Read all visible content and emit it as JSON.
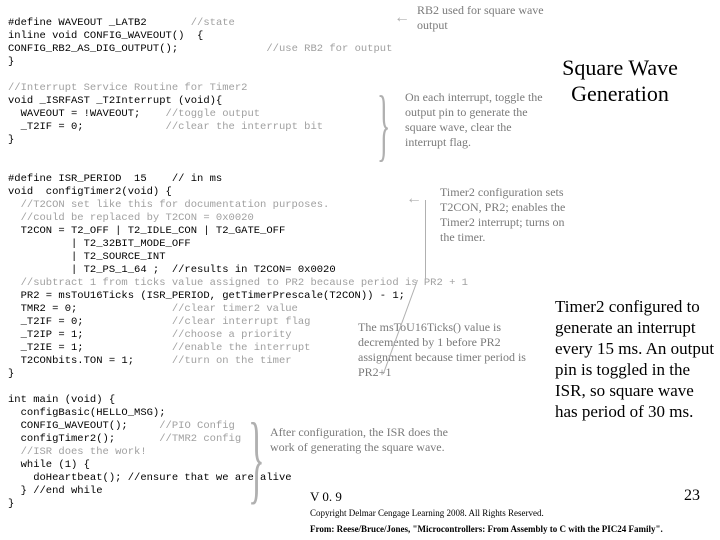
{
  "title": "Square Wave Generation",
  "code": {
    "def_waveout": "#define WAVEOUT _LATB2",
    "state_comment": "//state",
    "inline_sig": "inline void CONFIG_WAVEOUT()  {",
    "config_rb2": "CONFIG_RB2_AS_DIG_OUTPUT();",
    "use_rb2_comment": "//use RB2 for output",
    "close1": "}",
    "isr_hdr": "//Interrupt Service Routine for Timer2",
    "isr_sig": "void _ISRFAST _T2Interrupt (void){",
    "isr_l1a": "  WAVEOUT = !WAVEOUT;",
    "isr_l1b": "//toggle output",
    "isr_l2a": "  _T2IF = 0;",
    "isr_l2b": "//clear the interrupt bit",
    "close2": "}",
    "def_period": "#define ISR_PERIOD  15    // in ms",
    "cfg_sig": "void  configTimer2(void) {",
    "cfg_c1": "  //T2CON set like this for documentation purposes.",
    "cfg_c2": "  //could be replaced by T2CON = 0x0020",
    "cfg_l1": "  T2CON = T2_OFF | T2_IDLE_CON | T2_GATE_OFF",
    "cfg_l2": "          | T2_32BIT_MODE_OFF",
    "cfg_l3": "          | T2_SOURCE_INT",
    "cfg_l4": "          | T2_PS_1_64 ;  //results in T2CON= 0x0020",
    "cfg_c3": "  //subtract 1 from ticks value assigned to PR2 because period is PR2 + 1",
    "cfg_l5": "  PR2 = msToU16Ticks (ISR_PERIOD, getTimerPrescale(T2CON)) - 1;",
    "cfg_l6a": "  TMR2 = 0;",
    "cfg_l6b": "//clear timer2 value",
    "cfg_l7a": "  _T2IF = 0;",
    "cfg_l7b": "//clear interrupt flag",
    "cfg_l8a": "  _T2IP = 1;",
    "cfg_l8b": "//choose a priority",
    "cfg_l9a": "  _T2IE = 1;",
    "cfg_l9b": "//enable the interrupt",
    "cfg_l10a": "  T2CONbits.TON = 1;",
    "cfg_l10b": "//turn on the timer",
    "close3": "}",
    "main_sig": "int main (void) {",
    "main_l1": "  configBasic(HELLO_MSG);",
    "main_l2a": "  CONFIG_WAVEOUT();",
    "main_l2b": "//PIO Config",
    "main_l3a": "  configTimer2();",
    "main_l3b": "//TMR2 config",
    "main_l4": "  //ISR does the work!",
    "main_l5": "  while (1) {",
    "main_l6": "    doHeartbeat(); //ensure that we are alive",
    "main_l7": "  } //end while",
    "close4": "}"
  },
  "annotations": {
    "rb2": "RB2 used for square wave output",
    "isr_note": "On each interrupt, toggle the output pin to generate the square wave, clear the interrupt flag.",
    "t2cfg": "Timer2 configuration sets T2CON, PR2; enables the Timer2 interrupt; turns on the timer.",
    "ticks": "The msToU16Ticks() value is decremented by 1 before PR2 assignment because timer period is PR2+1",
    "main": "After configuration, the ISR does the work of generating the square wave."
  },
  "paragraph": "Timer2 configured to generate an interrupt every 15 ms. An output pin is toggled in the ISR, so square wave has period of 30 ms.",
  "version": "V 0. 9",
  "page": "23",
  "footer1": "Copyright Delmar Cengage Learning 2008. All Rights Reserved.",
  "footer2": "From: Reese/Bruce/Jones, \"Microcontrollers: From Assembly to C with the PIC24 Family\"."
}
